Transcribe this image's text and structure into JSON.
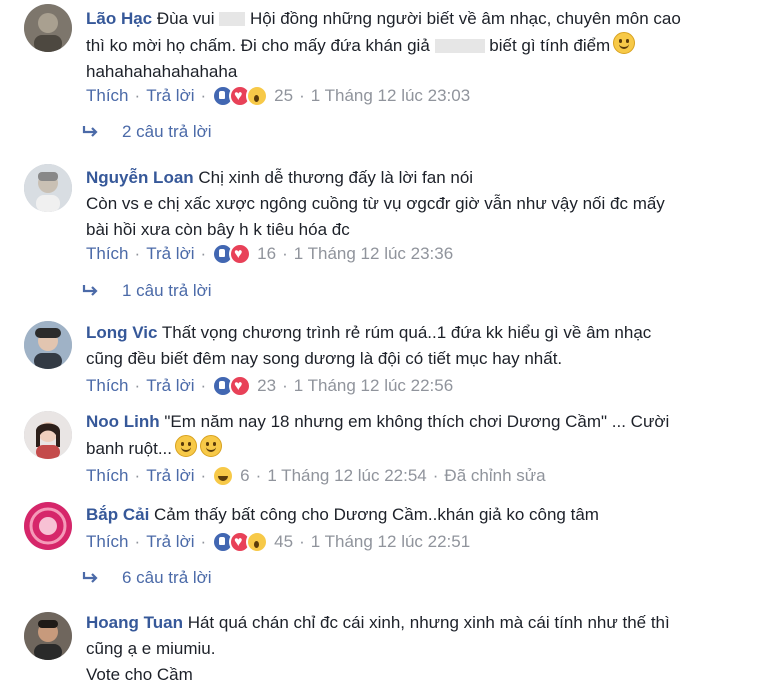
{
  "colors": {
    "author": "#365899",
    "link": "#4b6aa8",
    "meta": "#90949c",
    "text": "#1d2129"
  },
  "labels": {
    "like": "Thích",
    "reply": "Trả lời",
    "separator": "·"
  },
  "comments": [
    {
      "author": "Lão Hạc",
      "text_line1": "Đùa vui ",
      "text_line1b": " Hội đồng những người biết về âm nhạc, chuyên môn cao",
      "text_line2": "thì ko mời họ chấm. Đi cho mấy đứa khán giả ",
      "text_line2b": " biết gì tính điểm",
      "text_line3": "hahahahahahahaha",
      "reactions": [
        "like",
        "love",
        "wow"
      ],
      "reaction_count": "25",
      "time": "1 Tháng 12 lúc 23:03",
      "replies": "2 câu trả lời"
    },
    {
      "author": "Nguyễn Loan",
      "text_line1": "Chị xinh dễ thương đấy là lời fan nói",
      "text_line2": "Còn vs e chị xấc xược ngông cuồng từ vụ ơgcđr giờ vẫn như vậy nối đc mấy",
      "text_line3": "bài hồi xưa còn bây h k tiêu hóa đc",
      "reactions": [
        "like",
        "love"
      ],
      "reaction_count": "16",
      "time": "1 Tháng 12 lúc 23:36",
      "replies": "1 câu trả lời"
    },
    {
      "author": "Long Vic",
      "text_line1": "Thất vọng chương trình rẻ rúm quá..1 đứa kk hiểu gì về âm nhạc",
      "text_line2": "cũng đều biết đêm nay song dương là đội có tiết mục hay nhất.",
      "reactions": [
        "like",
        "love"
      ],
      "reaction_count": "23",
      "time": "1 Tháng 12 lúc 22:56"
    },
    {
      "author": "Noo Linh",
      "text_line1": "\"Em năm nay 18 nhưng em không thích chơi Dương Cầm\" ... Cười",
      "text_line2": "banh ruột...",
      "reactions": [
        "haha"
      ],
      "reaction_count": "6",
      "time": "1 Tháng 12 lúc 22:54",
      "edited": "Đã chỉnh sửa"
    },
    {
      "author": "Bắp Cải",
      "text_line1": "Cảm thấy bất công cho Dương Cầm..khán giả ko công tâm",
      "reactions": [
        "like",
        "love",
        "wow"
      ],
      "reaction_count": "45",
      "time": "1 Tháng 12 lúc 22:51",
      "replies": "6 câu trả lời"
    },
    {
      "author": "Hoang Tuan",
      "text_line1": "Hát quá chán chỉ đc cái xinh, nhưng xinh mà cái tính như thế thì",
      "text_line2": "cũng ạ e miumiu.",
      "text_line3": "Vote cho Cầm"
    }
  ]
}
